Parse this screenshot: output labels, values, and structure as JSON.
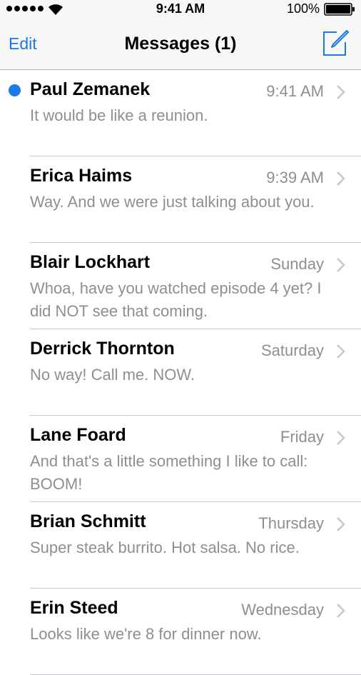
{
  "status_bar": {
    "time": "9:41 AM",
    "battery_percent": "100%",
    "battery_level": 1.0,
    "signal_bars": 5
  },
  "nav": {
    "edit_label": "Edit",
    "title": "Messages (1)",
    "compose_icon": "compose-icon"
  },
  "colors": {
    "accent": "#1a7ae8",
    "secondary_text": "#8e8e93"
  },
  "messages": [
    {
      "name": "Paul Zemanek",
      "time": "9:41 AM",
      "preview": "It would be like a reunion.",
      "unread": true
    },
    {
      "name": "Erica Haims",
      "time": "9:39 AM",
      "preview": "Way. And we were just talking about you.",
      "unread": false
    },
    {
      "name": "Blair Lockhart",
      "time": "Sunday",
      "preview": "Whoa, have you watched episode 4 yet? I did NOT see that coming.",
      "unread": false
    },
    {
      "name": "Derrick Thornton",
      "time": "Saturday",
      "preview": "No way! Call me. NOW.",
      "unread": false
    },
    {
      "name": "Lane Foard",
      "time": "Friday",
      "preview": "And that's a little something I like to call: BOOM!",
      "unread": false
    },
    {
      "name": "Brian Schmitt",
      "time": "Thursday",
      "preview": "Super steak burrito. Hot salsa. No rice.",
      "unread": false
    },
    {
      "name": "Erin Steed",
      "time": "Wednesday",
      "preview": "Looks like we're 8 for dinner now.",
      "unread": false
    }
  ]
}
